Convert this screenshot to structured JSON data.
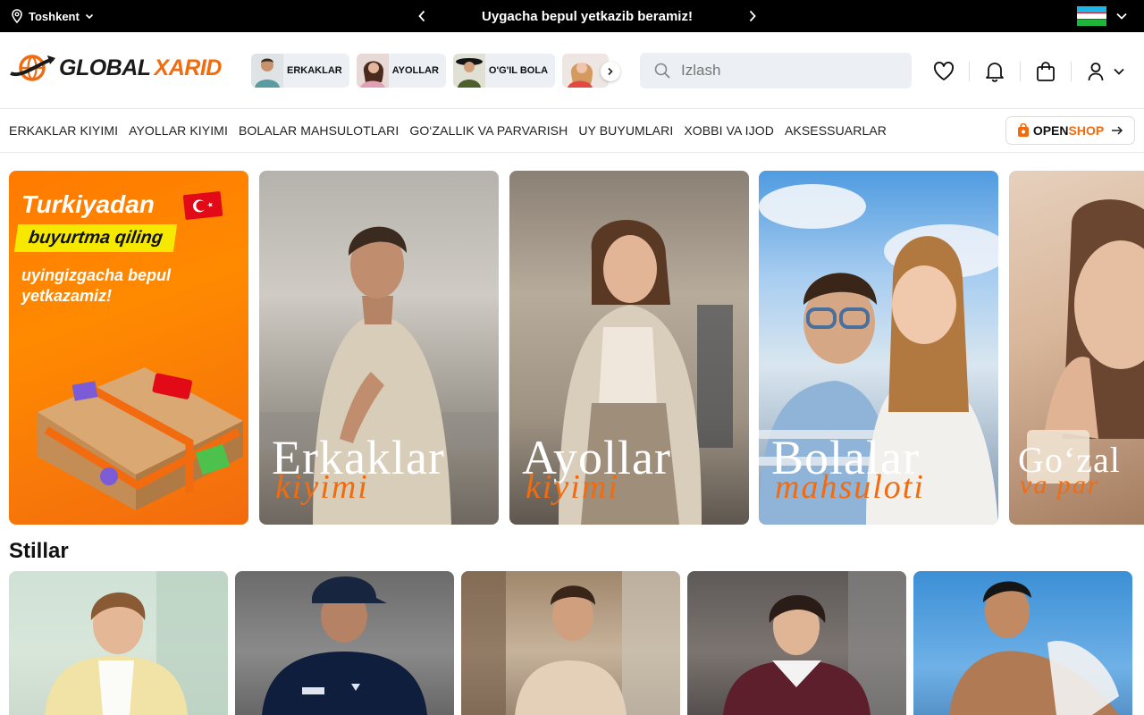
{
  "topbar": {
    "location": "Toshkent",
    "promo_message": "Uygacha bepul yetkazib beramiz!",
    "language_flag": "uz"
  },
  "header": {
    "logo": {
      "part1": "GLOBAL",
      "part2": "XARID"
    },
    "chips": [
      {
        "label": "ERKAKLAR"
      },
      {
        "label": "AYOLLAR"
      },
      {
        "label": "O'G'IL BOLA"
      }
    ],
    "search": {
      "placeholder": "Izlash",
      "value": ""
    }
  },
  "catnav": {
    "items": [
      "ERKAKLAR KIYIMI",
      "AYOLLAR KIYIMI",
      "BOLALAR MAHSULOTLARI",
      "GO‘ZALLIK VA PARVARISH",
      "UY BUYUMLARI",
      "XOBBI VA IJOD",
      "AKSESSUARLAR"
    ],
    "openshop": {
      "part1": "OPEN",
      "part2": "SHOP"
    }
  },
  "banners": {
    "promo": {
      "line1": "Turkiyadan",
      "line2": "buyurtma qiling",
      "line3": "uyingizgacha bepul yetkazamiz!"
    },
    "cards": [
      {
        "title": "Erkaklar",
        "subtitle": "kiyimi"
      },
      {
        "title": "Ayollar",
        "subtitle": "kiyimi"
      },
      {
        "title": "Bolalar",
        "subtitle": "mahsuloti"
      },
      {
        "title": "Go‘zal",
        "subtitle": "va par"
      }
    ]
  },
  "styles_section": {
    "title": "Stillar"
  },
  "colors": {
    "accent": "#f26b0f",
    "topbar": "#000000",
    "chip_bg": "#eceff3"
  }
}
